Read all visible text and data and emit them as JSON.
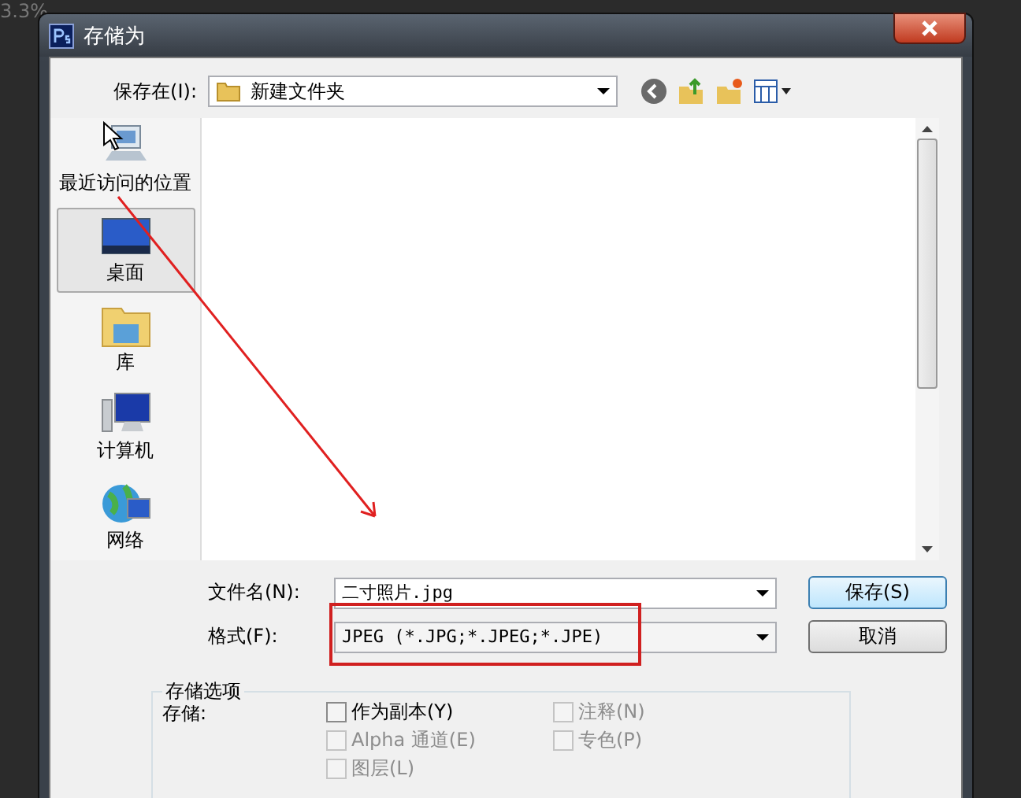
{
  "background": {
    "text": "3.3%"
  },
  "window": {
    "title": "存储为"
  },
  "save_in": {
    "label": "保存在(I):",
    "value": "新建文件夹"
  },
  "places": [
    {
      "label": "最近访问的位置",
      "kind": "recent",
      "selected": false
    },
    {
      "label": "桌面",
      "kind": "desktop",
      "selected": true
    },
    {
      "label": "库",
      "kind": "library",
      "selected": false
    },
    {
      "label": "计算机",
      "kind": "computer",
      "selected": false
    },
    {
      "label": "网络",
      "kind": "network",
      "selected": false
    }
  ],
  "file_name": {
    "label": "文件名(N):",
    "value": "二寸照片.jpg"
  },
  "format": {
    "label": "格式(F):",
    "value": "JPEG (*.JPG;*.JPEG;*.JPE)"
  },
  "buttons": [
    {
      "label": "保存(S)",
      "kind": "default"
    },
    {
      "label": "取消",
      "kind": "normal"
    }
  ],
  "options": {
    "title": "存储选项",
    "save_label": "存储:",
    "checkboxes": [
      {
        "label": "作为副本(Y)",
        "checked": false,
        "disabled": false
      },
      {
        "label": "注释(N)",
        "checked": false,
        "disabled": true
      },
      {
        "label": "Alpha 通道(E)",
        "checked": false,
        "disabled": true
      },
      {
        "label": "专色(P)",
        "checked": false,
        "disabled": true
      },
      {
        "label": "图层(L)",
        "checked": false,
        "disabled": true
      }
    ]
  }
}
